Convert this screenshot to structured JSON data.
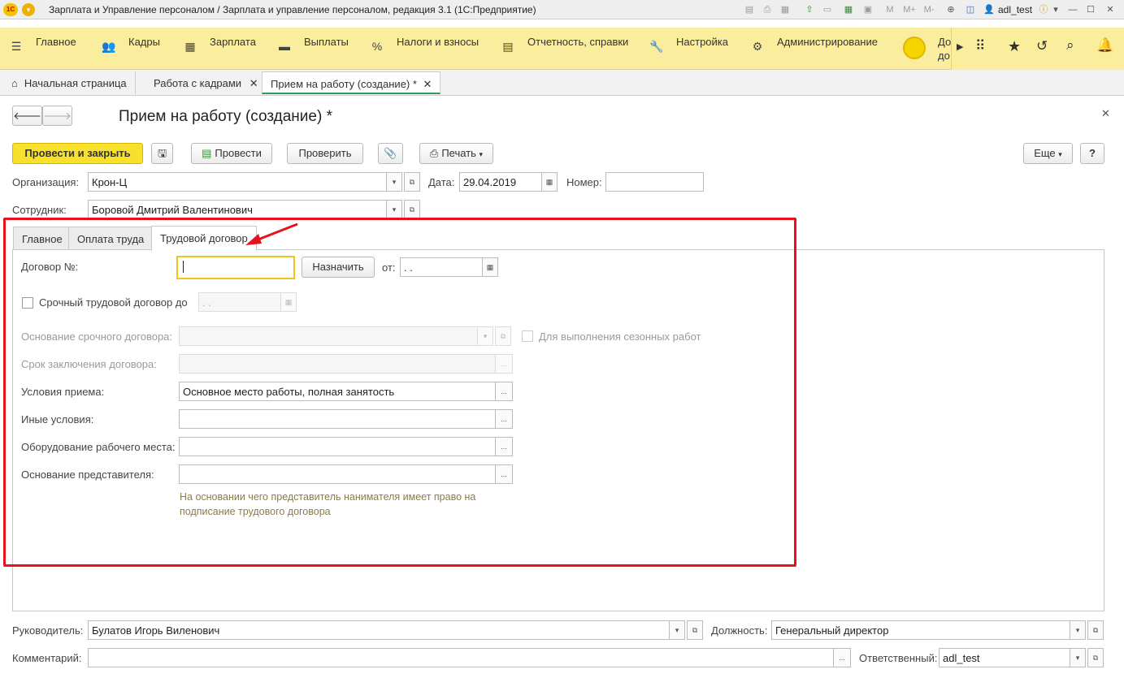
{
  "window": {
    "title": "Зарплата и Управление персоналом / Зарплата и управление персоналом, редакция 3.1  (1С:Предприятие)",
    "logo": "1С",
    "username": "adl_test",
    "toolbar_labels": [
      "M",
      "M+",
      "M-"
    ]
  },
  "menu": {
    "items": [
      {
        "label": "Главное",
        "icon": "hamburger-icon"
      },
      {
        "label": "Кадры",
        "icon": "people-icon"
      },
      {
        "label": "Зарплата",
        "icon": "calculator-icon"
      },
      {
        "label": "Выплаты",
        "icon": "wallet-icon"
      },
      {
        "label": "Налоги и взносы",
        "icon": "percent-icon"
      },
      {
        "label": "Отчетность, справки",
        "icon": "report-icon"
      },
      {
        "label": "Настройка",
        "icon": "wrench-icon"
      },
      {
        "label": "Администрирование",
        "icon": "gear-icon"
      }
    ],
    "extra_label_top": "До",
    "extra_label_bottom": "до"
  },
  "tabs": {
    "home": "Начальная страница",
    "hr": "Работа с кадрами",
    "current": "Прием на работу (создание) *"
  },
  "form": {
    "title": "Прием на работу (создание) *",
    "buttons": {
      "post_close": "Провести и закрыть",
      "post": "Провести",
      "check": "Проверить",
      "print": "Печать",
      "more": "Еще",
      "help": "?"
    },
    "organization_label": "Организация:",
    "organization_value": "Крон-Ц",
    "date_label": "Дата:",
    "date_value": "29.04.2019",
    "number_label": "Номер:",
    "number_value": "",
    "employee_label": "Сотрудник:",
    "employee_value": "Боровой Дмитрий Валентинович"
  },
  "form_tabs": [
    "Главное",
    "Оплата труда",
    "Трудовой договор"
  ],
  "contract": {
    "number_label": "Договор №:",
    "number_value": "",
    "assign_button": "Назначить",
    "from_label": "от:",
    "from_value": " .  .",
    "fixed_term_label": "Срочный трудовой договор до",
    "fixed_term_date": " .  .",
    "basis_label": "Основание срочного договора:",
    "basis_value": "",
    "seasonal_label": "Для выполнения сезонных работ",
    "term_label": "Срок заключения договора:",
    "term_value": "",
    "conditions_label": "Условия приема:",
    "conditions_value": "Основное место работы, полная занятость",
    "other_label": "Иные условия:",
    "other_value": "",
    "equipment_label": "Оборудование рабочего места:",
    "equipment_value": "",
    "rep_basis_label": "Основание представителя:",
    "rep_basis_value": "",
    "rep_hint": "На основании чего представитель нанимателя имеет право на\nподписание трудового договора"
  },
  "footer": {
    "manager_label": "Руководитель:",
    "manager_value": "Булатов Игорь Виленович",
    "position_label": "Должность:",
    "position_value": "Генеральный директор",
    "comment_label": "Комментарий:",
    "comment_value": "",
    "responsible_label": "Ответственный:",
    "responsible_value": "adl_test"
  },
  "colors": {
    "menubar": "#fbed9e",
    "primary_button": "#f8e12c",
    "highlight_frame": "#e3141d",
    "focus_border": "#f0c419"
  }
}
